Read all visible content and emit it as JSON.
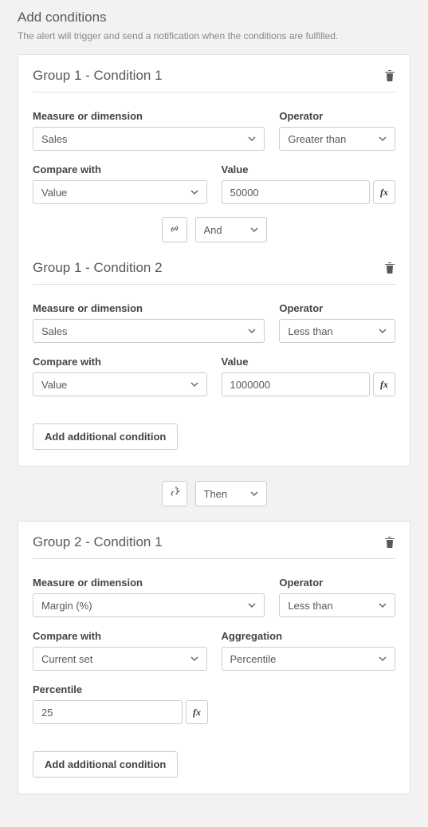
{
  "header": {
    "title": "Add conditions",
    "subtitle": "The alert will trigger and send a notification when the conditions are fulfilled."
  },
  "labels": {
    "measure": "Measure or dimension",
    "operator": "Operator",
    "compare": "Compare with",
    "value": "Value",
    "aggregation": "Aggregation",
    "percentile": "Percentile",
    "add_condition": "Add additional condition",
    "fx": "fx"
  },
  "group1": {
    "condition1": {
      "title": "Group 1 - Condition 1",
      "measure": "Sales",
      "operator": "Greater than",
      "compare": "Value",
      "value": "50000"
    },
    "connector": "And",
    "condition2": {
      "title": "Group 1 - Condition 2",
      "measure": "Sales",
      "operator": "Less than",
      "compare": "Value",
      "value": "1000000"
    }
  },
  "group_connector": "Then",
  "group2": {
    "condition1": {
      "title": "Group 2 - Condition 1",
      "measure": "Margin (%)",
      "operator": "Less than",
      "compare": "Current set",
      "aggregation": "Percentile",
      "percentile": "25"
    }
  }
}
